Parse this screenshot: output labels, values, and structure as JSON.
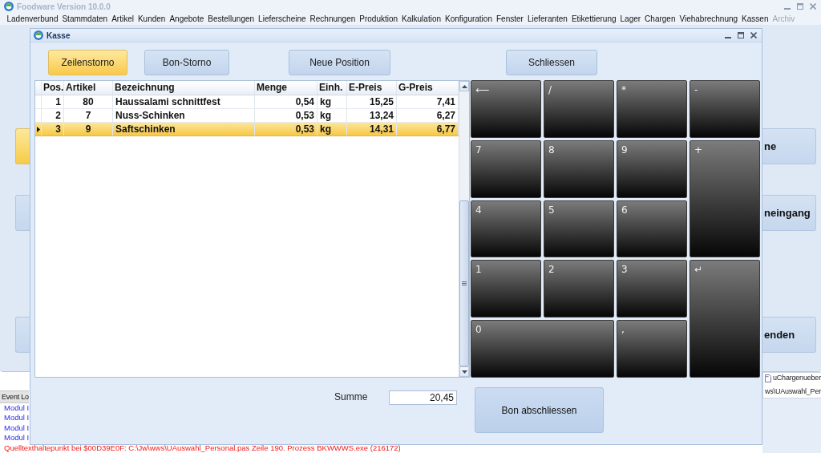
{
  "app": {
    "title": "Foodware Version 10.0.0",
    "menu": [
      {
        "label": "Ladenverbund",
        "disabled": false
      },
      {
        "label": "Stammdaten",
        "disabled": false
      },
      {
        "label": "Artikel",
        "disabled": false
      },
      {
        "label": "Kunden",
        "disabled": false
      },
      {
        "label": "Angebote",
        "disabled": false
      },
      {
        "label": "Bestellungen",
        "disabled": false
      },
      {
        "label": "Lieferscheine",
        "disabled": false
      },
      {
        "label": "Rechnungen",
        "disabled": false
      },
      {
        "label": "Produktion",
        "disabled": false
      },
      {
        "label": "Kalkulation",
        "disabled": false
      },
      {
        "label": "Konfiguration",
        "disabled": false
      },
      {
        "label": "Fenster",
        "disabled": false
      },
      {
        "label": "Lieferanten",
        "disabled": false
      },
      {
        "label": "Etikettierung",
        "disabled": false
      },
      {
        "label": "Lager",
        "disabled": false
      },
      {
        "label": "Chargen",
        "disabled": false
      },
      {
        "label": "Viehabrechnung",
        "disabled": false
      },
      {
        "label": "Kassen",
        "disabled": false
      },
      {
        "label": "Archiv",
        "disabled": true
      }
    ],
    "left_buttons": [
      {
        "highlighted": true
      },
      {
        "highlighted": false
      },
      {
        "highlighted": false
      }
    ],
    "right_buttons": [
      {
        "label": "ne",
        "highlighted": false
      },
      {
        "label": "neingang",
        "highlighted": false
      },
      {
        "label": "enden",
        "highlighted": false
      }
    ],
    "event_log": {
      "title": "Event Lo",
      "entries": [
        {
          "kind": "info",
          "text": "Modul I"
        },
        {
          "kind": "info",
          "text": "Modul I"
        },
        {
          "kind": "info",
          "text": "Modul I"
        },
        {
          "kind": "info",
          "text": "Modul I"
        },
        {
          "kind": "error",
          "text": "Quelltexthaltepunkt bei $00D39E0F: C:\\Jw\\wws\\UAuswahl_Personal.pas Zeile 190. Prozess BKWWWS.exe (216172)"
        }
      ]
    },
    "file_panel": {
      "name": "uChargenueber",
      "path": "ws\\UAuswahl_Per"
    }
  },
  "dialog": {
    "title": "Kasse",
    "toolbar": [
      {
        "label": "Zeilenstorno",
        "highlighted": true
      },
      {
        "label": "Bon-Storno",
        "highlighted": false
      },
      {
        "label": "Neue Position",
        "highlighted": false
      },
      {
        "label": "Schliessen",
        "highlighted": false
      }
    ],
    "table": {
      "columns": [
        "Pos.",
        "Artikel",
        "Bezeichnung",
        "Menge",
        "Einh.",
        "E-Preis",
        "G-Preis"
      ],
      "rows": [
        {
          "cells": [
            "1",
            "80",
            "Haussalami schnittfest",
            "0,54",
            "kg",
            "15,25",
            "7,41"
          ],
          "selected": false
        },
        {
          "cells": [
            "2",
            "7",
            "Nuss-Schinken",
            "0,53",
            "kg",
            "13,24",
            "6,27"
          ],
          "selected": false
        },
        {
          "cells": [
            "3",
            "9",
            "Saftschinken",
            "0,53",
            "kg",
            "14,31",
            "6,77"
          ],
          "selected": true
        }
      ]
    },
    "keypad": [
      "⟵",
      "/",
      "*",
      "-",
      "7",
      "8",
      "9",
      "+",
      "4",
      "5",
      "6",
      "1",
      "2",
      "3",
      "↵",
      "0",
      ","
    ],
    "sum": {
      "label": "Summe",
      "value": "20,45"
    },
    "finish_button": "Bon abschliessen"
  }
}
